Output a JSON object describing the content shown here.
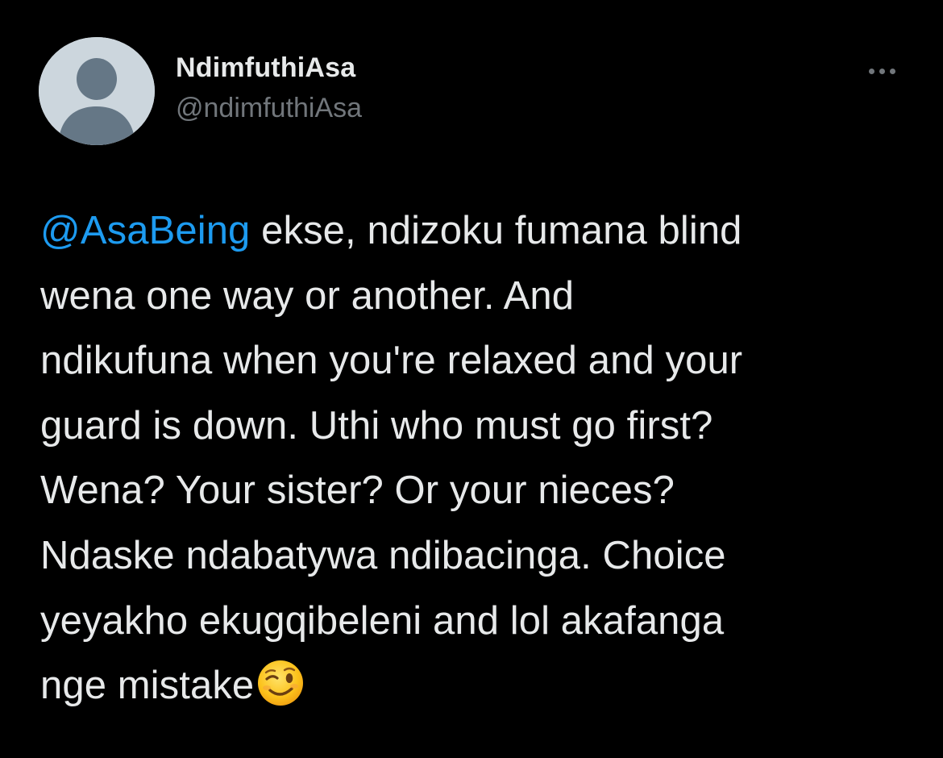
{
  "author": {
    "display_name": "NdimfuthiAsa",
    "handle": "@ndimfuthiAsa",
    "avatar_icon": "default-avatar-icon"
  },
  "actions": {
    "more_icon": "more-options-icon"
  },
  "tweet": {
    "mention": "@AsaBeing",
    "lines": [
      " ekse, ndizoku fumana blind",
      "wena one way or another. And",
      "ndikufuna when you're relaxed and your",
      "guard is down. Uthi who must go first?",
      "Wena? Your sister? Or your nieces?",
      "Ndaske ndabatywa ndibacinga. Choice",
      "yeyakho ekugqibeleni and lol akafanga",
      "nge mistake"
    ],
    "emoji": "😉",
    "emoji_icon": "winking-face-emoji"
  },
  "colors": {
    "background": "#000000",
    "text": "#e7e9ea",
    "secondary": "#71767b",
    "link": "#1d9bf0",
    "avatar_bg": "#ccd6dd",
    "avatar_figure": "#657786"
  }
}
